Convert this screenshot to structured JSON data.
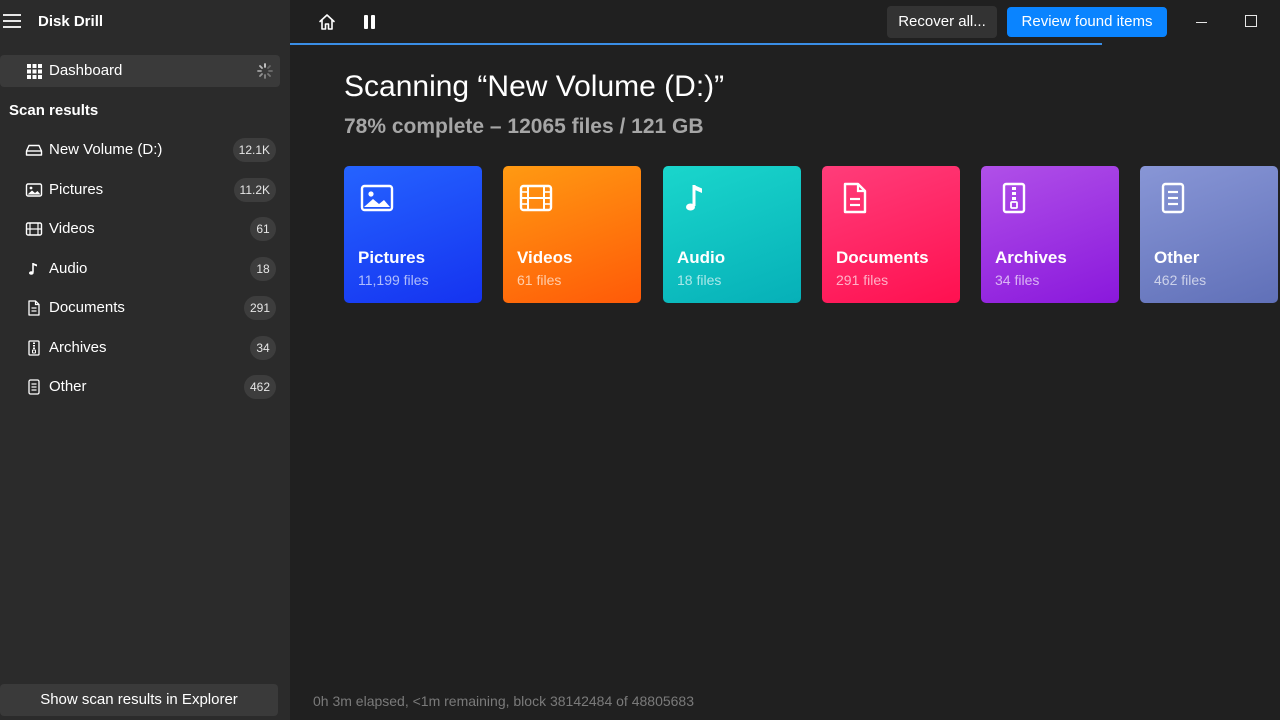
{
  "app": {
    "title": "Disk Drill"
  },
  "sidebar": {
    "dashboard_label": "Dashboard",
    "section_title": "Scan results",
    "items": [
      {
        "label": "New Volume (D:)",
        "badge": "12.1K",
        "icon": "drive-icon"
      },
      {
        "label": "Pictures",
        "badge": "11.2K",
        "icon": "picture-icon"
      },
      {
        "label": "Videos",
        "badge": "61",
        "icon": "film-icon"
      },
      {
        "label": "Audio",
        "badge": "18",
        "icon": "music-note-icon"
      },
      {
        "label": "Documents",
        "badge": "291",
        "icon": "document-icon"
      },
      {
        "label": "Archives",
        "badge": "34",
        "icon": "archive-icon"
      },
      {
        "label": "Other",
        "badge": "462",
        "icon": "other-file-icon"
      }
    ],
    "explorer_button": "Show scan results in Explorer"
  },
  "toolbar": {
    "recover_label": "Recover all...",
    "review_label": "Review found items",
    "accent": "#0a84ff"
  },
  "scan": {
    "title": "Scanning “New Volume (D:)”",
    "subtitle": "78% complete – 12065 files / 121 GB",
    "progress": 0.82,
    "status": "0h 3m elapsed, <1m remaining, block 38142484 of 48805683"
  },
  "cards": [
    {
      "name": "Pictures",
      "count": "11,199 files",
      "icon": "picture-icon",
      "gradient": [
        "#2563ff",
        "#1533f0"
      ]
    },
    {
      "name": "Videos",
      "count": "61 files",
      "icon": "film-icon",
      "gradient": [
        "#ff9a12",
        "#ff5a08"
      ]
    },
    {
      "name": "Audio",
      "count": "18 files",
      "icon": "music-note-icon",
      "gradient": [
        "#1ad6cc",
        "#06b0b8"
      ]
    },
    {
      "name": "Documents",
      "count": "291 files",
      "icon": "document-icon",
      "gradient": [
        "#ff3d7a",
        "#ff1050"
      ]
    },
    {
      "name": "Archives",
      "count": "34 files",
      "icon": "archive-icon",
      "gradient": [
        "#b050e8",
        "#8a18dc"
      ]
    },
    {
      "name": "Other",
      "count": "462 files",
      "icon": "other-file-icon",
      "gradient": [
        "#8896d6",
        "#6070b8"
      ]
    }
  ]
}
